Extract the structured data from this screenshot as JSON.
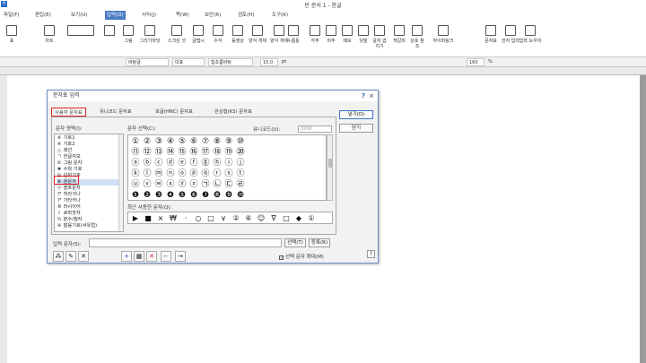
{
  "app": {
    "icon_glyph": "ㅎ",
    "title": "빈 문서 1 - 한글"
  },
  "menu": [
    {
      "label": "파일(F)"
    },
    {
      "label": "편집(E)"
    },
    {
      "label": "보기(U)"
    },
    {
      "label": "입력(D)"
    },
    {
      "label": "서식(J)"
    },
    {
      "label": "쪽(W)"
    },
    {
      "label": "보안(R)"
    },
    {
      "label": "검토(H)"
    },
    {
      "label": "도구(K)"
    }
  ],
  "ribbon": [
    {
      "label": "표"
    },
    {
      "label": "차트"
    },
    {
      "label": ""
    },
    {
      "label": ""
    },
    {
      "label": "그림"
    },
    {
      "label": "그리기마당"
    },
    {
      "label": "스크린 샷"
    },
    {
      "label": "글맵시"
    },
    {
      "label": "수식"
    },
    {
      "label": "동영상"
    },
    {
      "label": "양식 개체"
    },
    {
      "label": "양식 개체"
    },
    {
      "label": "누름틀"
    },
    {
      "label": "각주"
    },
    {
      "label": "미주"
    },
    {
      "label": "메모"
    },
    {
      "label": "덧말"
    },
    {
      "label": "글자 겹치기"
    },
    {
      "label": "책갈피"
    },
    {
      "label": "상호 참조"
    },
    {
      "label": "하이퍼링크"
    },
    {
      "label": "문자표"
    },
    {
      "label": "한자 입력"
    },
    {
      "label": "입력 도우미"
    }
  ],
  "formatbar": {
    "style": "바탕글",
    "language": "대표",
    "font": "함초롬바탕",
    "size": "10.0",
    "unit": "pt",
    "zoom": "160",
    "zoom_unit": "%"
  },
  "dialog": {
    "title": "문자표 입력",
    "help": "?",
    "close": "×",
    "tabs": [
      {
        "label": "사용자 문자표"
      },
      {
        "label": "유니코드 문자표"
      },
      {
        "label": "호글(HNC) 문자표"
      },
      {
        "label": "완성형(KS) 문자표"
      }
    ],
    "category_label": "문자 영역(I):",
    "categories": [
      {
        "icon": "※",
        "label": "기호1"
      },
      {
        "icon": "※",
        "label": "기호2"
      },
      {
        "icon": "△",
        "label": "괘선"
      },
      {
        "icon": "ㄱ",
        "label": "한글자모"
      },
      {
        "icon": "①",
        "label": "그림 문자"
      },
      {
        "icon": "✚",
        "label": "수학 기호"
      },
      {
        "icon": "◎",
        "label": "단위기호"
      },
      {
        "icon": "⑩",
        "label": "원문자"
      },
      {
        "icon": "ⓐ",
        "label": "괄호문자"
      },
      {
        "icon": "ア",
        "label": "히라가나"
      },
      {
        "icon": "ア",
        "label": "가타카나"
      },
      {
        "icon": "Я",
        "label": "러시아어"
      },
      {
        "icon": "Ⅰ",
        "label": "로마숫자"
      },
      {
        "icon": "½",
        "label": "분수/첨자"
      },
      {
        "icon": "※",
        "label": "발음기호(서유럽)"
      }
    ],
    "selected_category_index": 7,
    "char_select_label": "문자 선택(C):",
    "unicode_label": "유니코드(U):",
    "unicode_value": "3260",
    "grid_rows": [
      [
        "①",
        "②",
        "③",
        "④",
        "⑤",
        "⑥",
        "⑦",
        "⑧",
        "⑨",
        "⑩"
      ],
      [
        "⑪",
        "⑫",
        "⑬",
        "⑭",
        "⑮",
        "⑯",
        "⑰",
        "⑱",
        "⑲",
        "⑳"
      ],
      [
        "ⓐ",
        "ⓑ",
        "ⓒ",
        "ⓓ",
        "ⓔ",
        "ⓕ",
        "ⓖ",
        "ⓗ",
        "ⓘ",
        "ⓙ"
      ],
      [
        "ⓚ",
        "ⓛ",
        "ⓜ",
        "ⓝ",
        "ⓞ",
        "ⓟ",
        "ⓠ",
        "ⓡ",
        "ⓢ",
        "ⓣ"
      ],
      [
        "ⓤ",
        "ⓥ",
        "ⓦ",
        "ⓧ",
        "ⓨ",
        "ⓩ",
        "㉠",
        "㉡",
        "㉢",
        "㉣"
      ],
      [
        "❶",
        "❷",
        "❸",
        "❹",
        "❺",
        "❻",
        "❼",
        "❽",
        "❾",
        "❿"
      ]
    ],
    "recent_label": "최근 사용한 문자(Q):",
    "recent": [
      "▶",
      "■",
      "×",
      "₩",
      "·",
      "○",
      "□",
      "∨",
      "②",
      "⑥",
      "☺",
      "∇",
      "□",
      "◆",
      "①"
    ],
    "buttons": {
      "insert": "넣기(D)",
      "close": "닫기"
    },
    "input_label": "입력 문자(S):",
    "select_button": "선택(T)",
    "register_button": "등록(R)",
    "checkbox_label": "선택 문자 확대(M)",
    "checkbox_checked": true,
    "help_button": "?"
  }
}
